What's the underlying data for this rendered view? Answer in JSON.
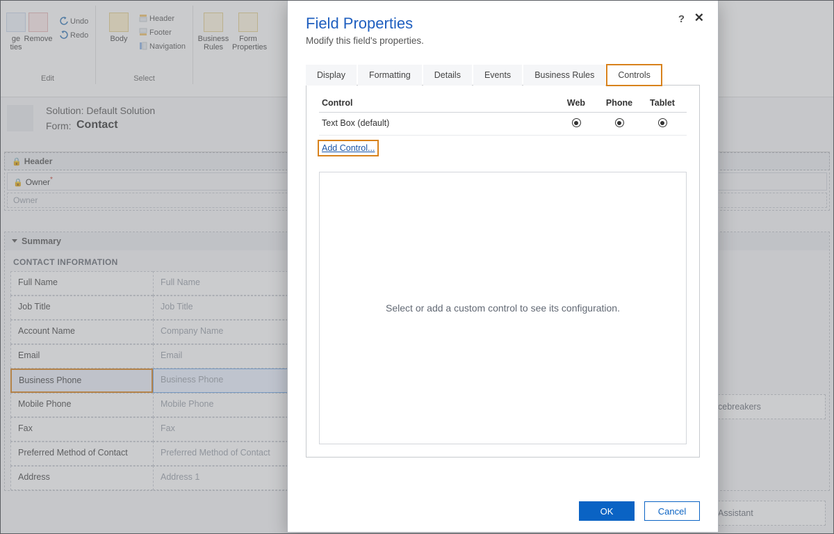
{
  "ribbon": {
    "edit_label": "Edit",
    "select_label": "Select",
    "remove": "Remove",
    "undo": "Undo",
    "redo": "Redo",
    "body": "Body",
    "header": "Header",
    "footer": "Footer",
    "navigation": "Navigation",
    "business_rules": "Business\nRules",
    "form_properties": "Form\nProperties",
    "change_properties": "ge\nties"
  },
  "form_header": {
    "solution_label": "Solution:",
    "solution_name": "Default Solution",
    "form_label": "Form:",
    "form_name": "Contact"
  },
  "canvas": {
    "header_section": "Header",
    "owner_label": "Owner",
    "owner_placeholder": "Owner",
    "summary": "Summary",
    "contact_info": "CONTACT INFORMATION",
    "fields": [
      {
        "label": "Full Name",
        "ph": "Full Name"
      },
      {
        "label": "Job Title",
        "ph": "Job Title"
      },
      {
        "label": "Account Name",
        "ph": "Company Name"
      },
      {
        "label": "Email",
        "ph": "Email"
      },
      {
        "label": "Business Phone",
        "ph": "Business Phone",
        "selected": true
      },
      {
        "label": "Mobile Phone",
        "ph": "Mobile Phone"
      },
      {
        "label": "Fax",
        "ph": "Fax"
      },
      {
        "label": "Preferred Method of Contact",
        "ph": "Preferred Method of Contact"
      },
      {
        "label": "Address",
        "ph": "Address 1"
      }
    ],
    "side1": "cebreakers",
    "side2": "Assistant"
  },
  "dialog": {
    "title": "Field Properties",
    "subtitle": "Modify this field's properties.",
    "help": "?",
    "close": "✕",
    "tabs": [
      "Display",
      "Formatting",
      "Details",
      "Events",
      "Business Rules",
      "Controls"
    ],
    "active_tab": 5,
    "controls_header": {
      "control": "Control",
      "web": "Web",
      "phone": "Phone",
      "tablet": "Tablet"
    },
    "controls_row": {
      "name": "Text Box (default)"
    },
    "add_control": "Add Control...",
    "cfg_placeholder": "Select or add a custom control to see its configuration.",
    "ok": "OK",
    "cancel": "Cancel"
  }
}
